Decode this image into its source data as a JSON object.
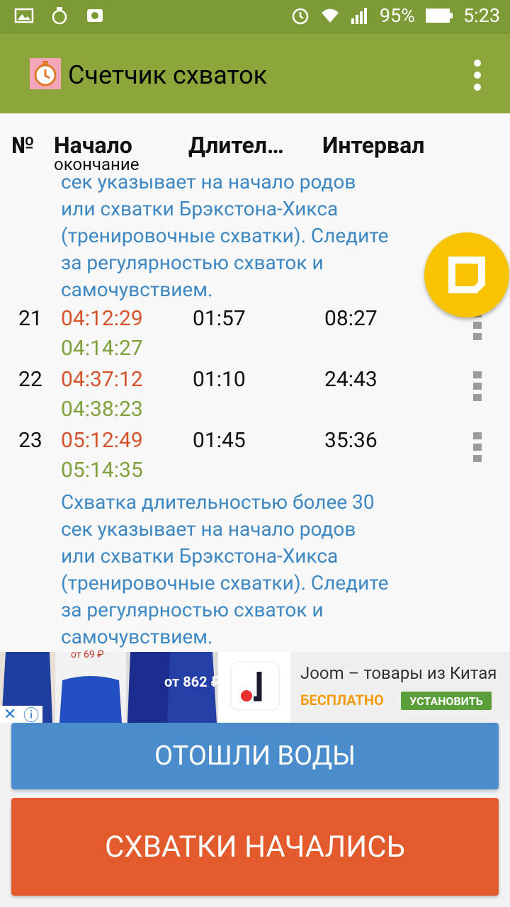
{
  "status_bar": {
    "battery": "95%",
    "time": "5:23"
  },
  "app": {
    "title": "Счетчик схваток"
  },
  "columns": {
    "num": "№",
    "start": "Начало",
    "start_sub": "окончание",
    "duration": "Длител…",
    "interval": "Интервал"
  },
  "note_top": [
    "сек указывает на начало родов",
    "или схватки Брэкстона-Хикса",
    "(тренировочные схватки). Следите",
    "за регулярностью схваток и",
    "самочувствием."
  ],
  "rows": [
    {
      "num": "21",
      "start": "04:12:29",
      "end": "04:14:27",
      "duration": "01:57",
      "interval": "08:27"
    },
    {
      "num": "22",
      "start": "04:37:12",
      "end": "04:38:23",
      "duration": "01:10",
      "interval": "24:43"
    },
    {
      "num": "23",
      "start": "05:12:49",
      "end": "05:14:35",
      "duration": "01:45",
      "interval": "35:36"
    }
  ],
  "note_bottom": [
    "Схватка длительностью более 30",
    "сек указывает на начало родов",
    "или схватки Брэкстона-Хикса",
    "(тренировочные схватки). Следите",
    "за регулярностью схваток и",
    "самочувствием."
  ],
  "ad": {
    "title": "Joom – товары из Китая",
    "free": "БЕСПЛАТНО",
    "install": "УСТАНОВИТЬ",
    "price1": "от 69 ₽",
    "price2": "от 862 ₽"
  },
  "buttons": {
    "water": "ОТОШЛИ ВОДЫ",
    "contractions": "СХВАТКИ НАЧАЛИСЬ"
  }
}
